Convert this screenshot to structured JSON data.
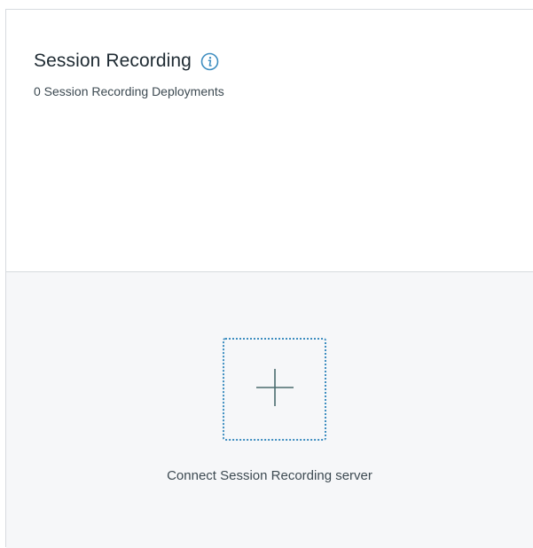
{
  "panel": {
    "title": "Session Recording",
    "info_icon": "info-icon",
    "subtitle": "0 Session Recording Deployments"
  },
  "add_server": {
    "icon": "plus-icon",
    "label": "Connect Session Recording server"
  },
  "colors": {
    "accent": "#3e8ec0",
    "plus": "#4a6b6e",
    "title_text": "#1f2b33",
    "body_text": "#3d4a52",
    "body_background": "#f6f7f9",
    "divider": "#d7dbdf"
  }
}
